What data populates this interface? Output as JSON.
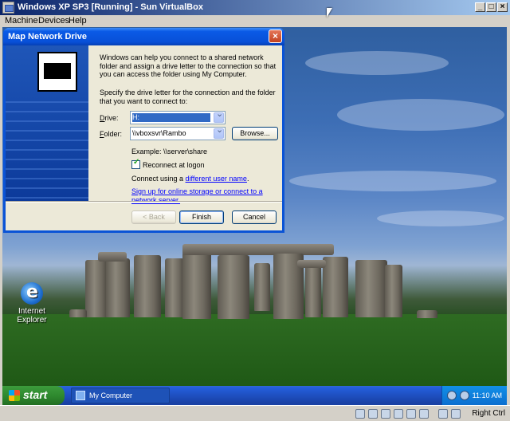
{
  "host": {
    "title": "Windows XP SP3 [Running] - Sun VirtualBox",
    "menu": [
      "Machine",
      "Devices",
      "Help"
    ],
    "window_buttons": [
      "_",
      "□",
      "X"
    ]
  },
  "dialog": {
    "title": "Map Network Drive",
    "intro": "Windows can help you connect to a shared network folder and assign a drive letter to the connection so that you can access the folder using My Computer.",
    "specify": "Specify the drive letter for the connection and the folder that you want to connect to:",
    "drive_label": "Drive:",
    "drive_value": "H:",
    "folder_label": "Folder:",
    "folder_value": "\\\\vboxsvr\\Rambo",
    "browse_label": "Browse...",
    "example": "Example: \\\\server\\share",
    "reconnect_label": "Reconnect at logon",
    "reconnect_checked": true,
    "connect_prefix": "Connect using a ",
    "connect_link": "different user name",
    "connect_suffix": ".",
    "signup_link": "Sign up for online storage or connect to a network server.",
    "back_label": "< Back",
    "finish_label": "Finish",
    "cancel_label": "Cancel"
  },
  "desktop": {
    "ie_label": "Internet Explorer"
  },
  "taskbar": {
    "start_label": "start",
    "task_label": "My Computer",
    "clock": "11:10 AM"
  },
  "statusbar": {
    "host_key": "Right Ctrl"
  }
}
